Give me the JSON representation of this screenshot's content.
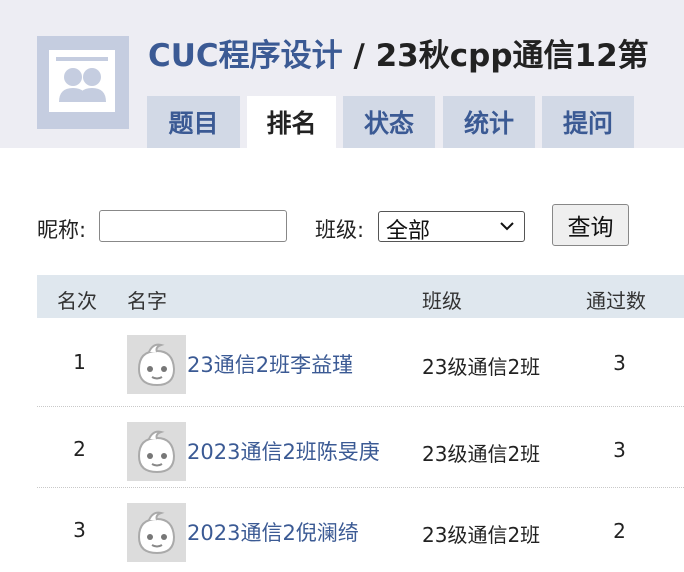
{
  "header": {
    "group_link": "CUC程序设计",
    "separator": "/",
    "contest_title": "23秋cpp通信12第"
  },
  "tabs": [
    {
      "label": "题目",
      "active": false
    },
    {
      "label": "排名",
      "active": true
    },
    {
      "label": "状态",
      "active": false
    },
    {
      "label": "统计",
      "active": false
    },
    {
      "label": "提问",
      "active": false
    }
  ],
  "filter": {
    "nickname_label": "昵称:",
    "nickname_value": "",
    "class_label": "班级:",
    "class_value": "全部",
    "query_button": "查询"
  },
  "table": {
    "columns": [
      "名次",
      "名字",
      "班级",
      "通过数"
    ],
    "rows": [
      {
        "rank": "1",
        "name": "23通信2班李益瑾",
        "class": "23级通信2班",
        "passed": "3"
      },
      {
        "rank": "2",
        "name": "2023通信2班陈旻庚",
        "class": "23级通信2班",
        "passed": "3"
      },
      {
        "rank": "3",
        "name": "2023通信2倪澜绮",
        "class": "23级通信2班",
        "passed": "2"
      }
    ]
  },
  "colors": {
    "header_bg": "#ededf3",
    "tab_bg": "#d2d9e6",
    "link": "#3b5a94",
    "table_head_bg": "#dfe7ee"
  }
}
